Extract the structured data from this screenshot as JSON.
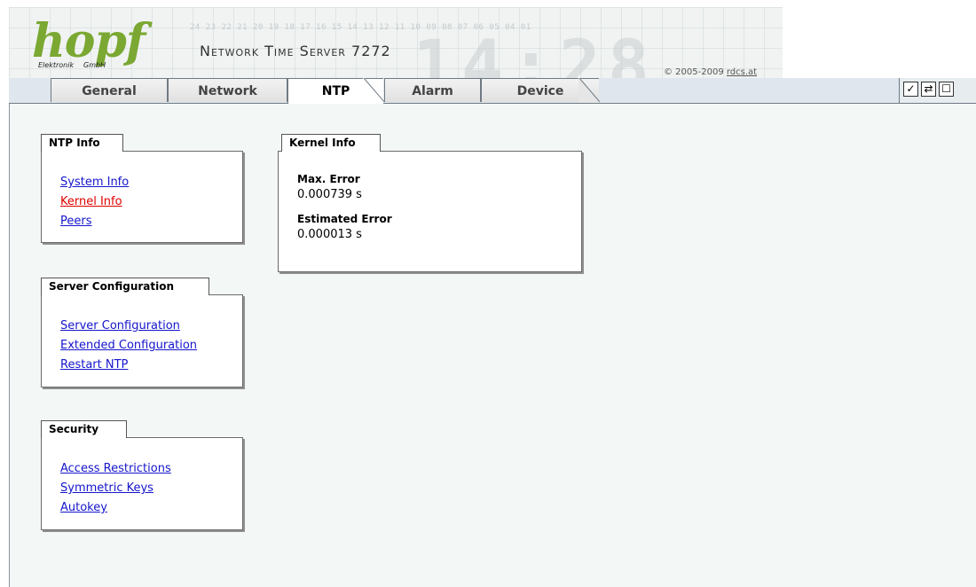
{
  "header": {
    "brand": "hopf",
    "brand_sub_left": "Elektronik",
    "brand_sub_right": "GmbH",
    "product_title": "Network Time Server 7272",
    "hour_scale": "24 23 22 21 20 19 18 17 16 15 14 13 12 11 10 09 08 07 06 05 04 01",
    "copyright_prefix": "© 2005-2009",
    "copyright_link": "rdcs.at",
    "brand_color": "#7aa832"
  },
  "tabs": [
    {
      "label": "General"
    },
    {
      "label": "Network"
    },
    {
      "label": "NTP",
      "active": true
    },
    {
      "label": "Alarm"
    },
    {
      "label": "Device"
    }
  ],
  "toolbar": {
    "icons": [
      "checkmark-icon",
      "refresh-icon",
      "page-icon"
    ],
    "check_glyph": "✓",
    "refresh_glyph": "⇄",
    "page_glyph": "☐"
  },
  "sidebar": {
    "ntp_info": {
      "title": "NTP Info",
      "links": [
        "System Info",
        "Kernel Info",
        "Peers"
      ],
      "current": "Kernel Info"
    },
    "server_config": {
      "title": "Server Configuration",
      "links": [
        "Server Configuration",
        "Extended Configuration",
        "Restart NTP"
      ]
    },
    "security": {
      "title": "Security",
      "links": [
        "Access Restrictions",
        "Symmetric Keys",
        "Autokey"
      ]
    }
  },
  "kernel_info": {
    "title": "Kernel Info",
    "max_error_label": "Max. Error",
    "max_error_value": "0.000739 s",
    "estimated_error_label": "Estimated Error",
    "estimated_error_value": "0.000013 s"
  },
  "colors": {
    "link": "#1515cc",
    "current_link": "#e00000",
    "content_bg": "#f3f7f6",
    "tab_band": "#dfe6ed"
  }
}
